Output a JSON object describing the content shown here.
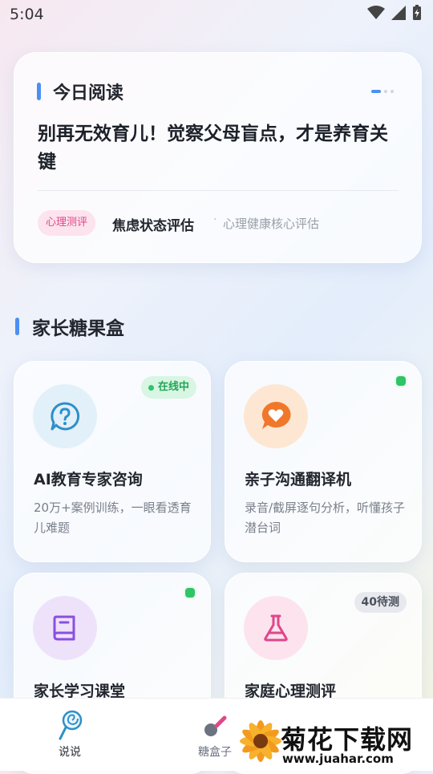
{
  "status": {
    "time": "5:04"
  },
  "today": {
    "title": "今日阅读",
    "headline": "别再无效育儿！觉察父母盲点，才是养育关键",
    "tag": "心理测评",
    "item_title": "焦虑状态评估",
    "separator": "·",
    "item_sub": "心理健康核心评估"
  },
  "section": {
    "title": "家长糖果盒"
  },
  "features": [
    {
      "title": "AI教育专家咨询",
      "desc": "20万+案例训练，一眼看透育儿难题",
      "badge": "在线中",
      "icon": "question-chat-icon",
      "color": "#2f8fc8"
    },
    {
      "title": "亲子沟通翻译机",
      "desc": "录音/截屏逐句分析，听懂孩子潜台词",
      "icon": "heart-chat-icon",
      "color": "#f0782a"
    },
    {
      "title": "家长学习课堂",
      "icon": "book-icon",
      "color": "#8a4fe0"
    },
    {
      "title": "家庭心理测评",
      "badge": "40待测",
      "icon": "flask-icon",
      "color": "#e0468a"
    }
  ],
  "nav": [
    {
      "label": "说说",
      "icon": "lollipop-icon",
      "active": true
    },
    {
      "label": "糖盒子",
      "icon": "candy-icon",
      "active": false
    }
  ],
  "watermark": {
    "text": "菊花下载网",
    "url": "www.juahar.com"
  }
}
